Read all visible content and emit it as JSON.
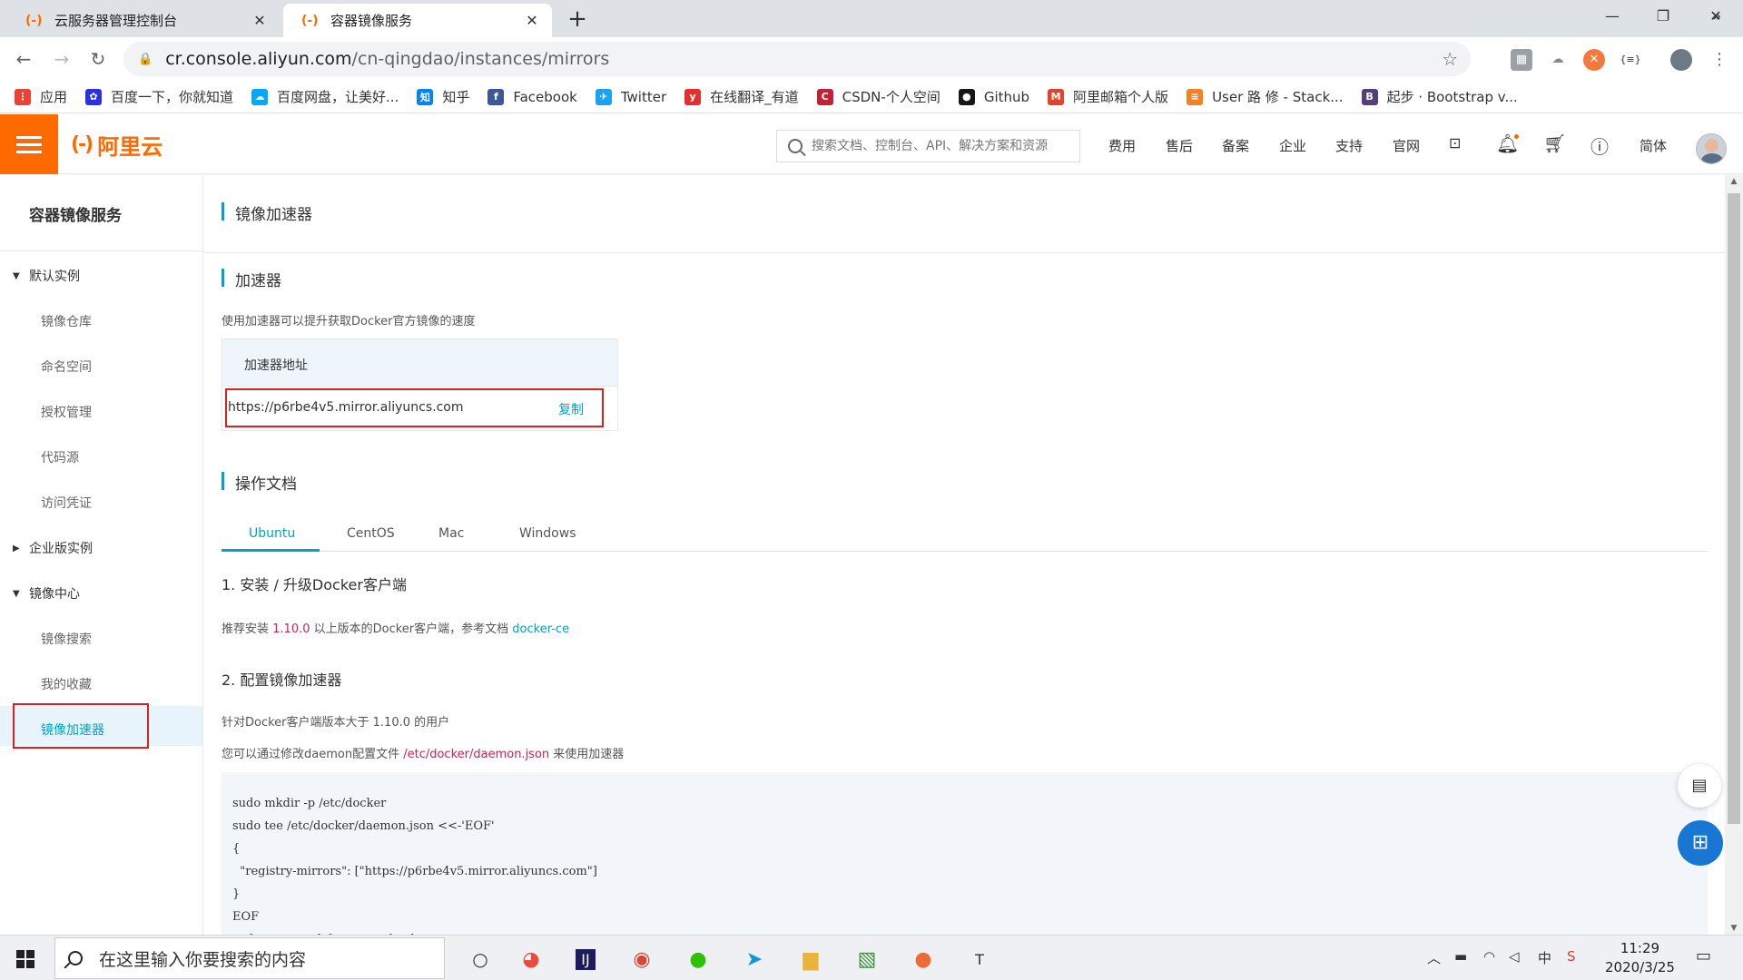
{
  "browser": {
    "tabs": [
      {
        "label": "云服务器管理控制台",
        "favicon": "(-)",
        "close": "✕"
      },
      {
        "label": "容器镜像服务",
        "favicon": "(-)",
        "close": "✕"
      }
    ],
    "new_tab": "+",
    "window_controls": {
      "minimize": "—",
      "maximize": "❐",
      "close": "✕"
    },
    "nav": {
      "back": "←",
      "forward": "→",
      "reload": "↻"
    },
    "url_host": "cr.console.aliyun.com",
    "url_path": "/cn-qingdao/instances/mirrors"
  },
  "bookmarks": [
    {
      "label": "应用",
      "icon": "apps-grid-icon",
      "color": "#ea4335",
      "glyph": "⋮"
    },
    {
      "label": "百度一下，你就知道",
      "icon": "baidu-icon",
      "color": "#2932e1",
      "glyph": "✿"
    },
    {
      "label": "百度网盘，让美好...",
      "icon": "baidu-netdisk-icon",
      "color": "#06a7ff",
      "glyph": "☁"
    },
    {
      "label": "知乎",
      "icon": "zhihu-icon",
      "color": "#0084ff",
      "glyph": "知"
    },
    {
      "label": "Facebook",
      "icon": "facebook-icon",
      "color": "#3b5998",
      "glyph": "f"
    },
    {
      "label": "Twitter",
      "icon": "twitter-icon",
      "color": "#1da1f2",
      "glyph": "✈"
    },
    {
      "label": "在线翻译_有道",
      "icon": "youdao-icon",
      "color": "#e52e2e",
      "glyph": "y"
    },
    {
      "label": "CSDN-个人空间",
      "icon": "csdn-icon",
      "color": "#c32136",
      "glyph": "C"
    },
    {
      "label": "Github",
      "icon": "github-icon",
      "color": "#181717",
      "glyph": "●"
    },
    {
      "label": "阿里邮箱个人版",
      "icon": "aliyun-mail-icon",
      "color": "#e0442a",
      "glyph": "M"
    },
    {
      "label": "User 路 修 - Stack...",
      "icon": "stackoverflow-icon",
      "color": "#f48024",
      "glyph": "≡"
    },
    {
      "label": "起步 · Bootstrap v...",
      "icon": "bootstrap-icon",
      "color": "#563d7c",
      "glyph": "B"
    }
  ],
  "bookmarks_more": "»",
  "topbar": {
    "logo_mark": "(-)",
    "logo_text": "阿里云",
    "search_placeholder": "搜索文档、控制台、API、解决方案和资源",
    "nav": [
      "费用",
      "售后",
      "备案",
      "企业",
      "支持",
      "官网"
    ],
    "lang": "简体"
  },
  "sidebar": {
    "title": "容器镜像服务",
    "groups": [
      {
        "label": "默认实例",
        "expanded": true,
        "items": [
          "镜像仓库",
          "命名空间",
          "授权管理",
          "代码源",
          "访问凭证"
        ]
      },
      {
        "label": "企业版实例",
        "expanded": false,
        "items": []
      },
      {
        "label": "镜像中心",
        "expanded": true,
        "items": [
          "镜像搜索",
          "我的收藏",
          "镜像加速器"
        ]
      }
    ],
    "active_item": "镜像加速器"
  },
  "main": {
    "page_title": "镜像加速器",
    "accel_section": "加速器",
    "accel_desc": "使用加速器可以提升获取Docker官方镜像的速度",
    "accel_header": "加速器地址",
    "accel_url": "https://p6rbe4v5.mirror.aliyuncs.com",
    "copy_label": "复制",
    "docs_section": "操作文档",
    "os_tabs": [
      "Ubuntu",
      "CentOS",
      "Mac",
      "Windows"
    ],
    "active_os_tab": "Ubuntu",
    "step1_title": "1. 安装 / 升级Docker客户端",
    "step1_pre": "推荐安装 ",
    "step1_version": "1.10.0",
    "step1_mid": " 以上版本的Docker客户端，参考文档 ",
    "step1_link": "docker-ce",
    "step2_title": "2. 配置镜像加速器",
    "step2_line1": "针对Docker客户端版本大于 1.10.0 的用户",
    "step2_line2_pre": "您可以通过修改daemon配置文件 ",
    "step2_path": "/etc/docker/daemon.json",
    "step2_line2_post": " 来使用加速器",
    "code": "sudo mkdir -p /etc/docker\nsudo tee /etc/docker/daemon.json <<-'EOF'\n{\n  \"registry-mirrors\": [\"https://p6rbe4v5.mirror.aliyuncs.com\"]\n}\nEOF\nsudo systemctl daemon-reload"
  },
  "taskbar": {
    "search_placeholder": "在这里输入你要搜索的内容",
    "time": "11:29",
    "date": "2020/3/25",
    "ime": "中"
  },
  "colors": {
    "brand": "#ff6a00",
    "accent": "#00a2ca",
    "highlight": "#e02020",
    "code_red": "#c7254e"
  }
}
